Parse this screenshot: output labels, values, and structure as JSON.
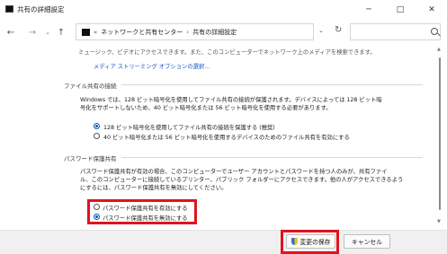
{
  "window": {
    "title": "共有の詳細設定",
    "minimize_glyph": "─",
    "maximize_glyph": "□",
    "close_glyph": "✕"
  },
  "nav": {
    "back_glyph": "←",
    "forward_glyph": "→",
    "history_glyph": "⌄",
    "up_glyph": "↑",
    "breadcrumb_prefix": "«",
    "breadcrumb_1": "ネットワークと共有センター",
    "breadcrumb_sep": "›",
    "breadcrumb_2": "共有の詳細設定",
    "dropdown_glyph": "⌄",
    "refresh_glyph": "↻"
  },
  "content": {
    "top_cut_line": "ミュージック、ビデオにアクセスできます。また、このコンピューターでネットワーク上のメディアを検索できます。",
    "media_link": "メディア ストリーミング オプションの選択...",
    "file_sharing": {
      "header": "ファイル共有の接続",
      "desc_line1": "Windows では、128 ビット暗号化を使用してファイル共有の接続が保護されます。デバイスによっては 128 ビット暗",
      "desc_line2": "号化をサポートしないため、40 ビット暗号化または 56 ビット暗号化を使用する必要があります。",
      "option1": "128 ビット暗号化を使用してファイル共有の接続を保護する (推奨)",
      "option2": "40 ビット暗号化または 56 ビット暗号化を使用するデバイスのためのファイル共有を有効にする"
    },
    "password": {
      "header": "パスワード保護共有",
      "desc_line1": "パスワード保護共有が有効の場合、このコンピューターでユーザー アカウントとパスワードを持つ人のみが、共有ファイ",
      "desc_line2": "ル、このコンピューターに接続しているプリンター、パブリック フォルダーにアクセスできます。他の人がアクセスできるよう",
      "desc_line3": "にするには、パスワード保護共有を無効にしてください。",
      "option_on": "パスワード保護共有を有効にする",
      "option_off": "パスワード保護共有を無効にする"
    }
  },
  "footer": {
    "save_label": "変更の保存",
    "cancel_label": "キャンセル"
  },
  "scroll": {
    "up_glyph": "▲",
    "down_glyph": "▼"
  },
  "colors": {
    "highlight": "#e0141e",
    "link": "#1a55c0",
    "radio_selected": "#0a58b5"
  }
}
